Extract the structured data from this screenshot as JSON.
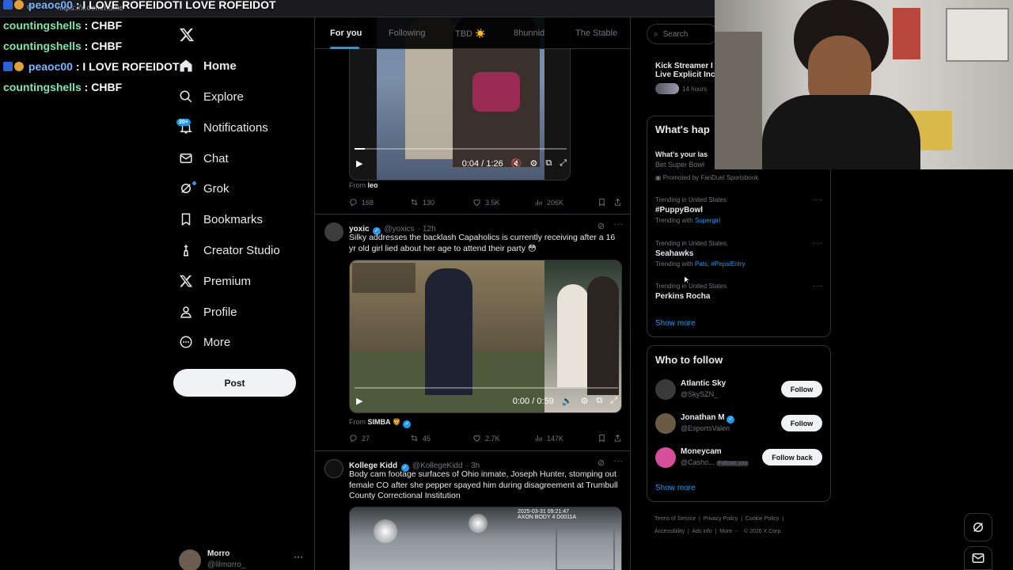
{
  "browser": {
    "url": "https://x.com/home"
  },
  "chat": {
    "lines": [
      {
        "user": "peaoc00",
        "msg": " : I LOVE ROFEIDOTI LOVE ROFEIDOT"
      },
      {
        "user": "countingshells",
        "msg": " : CHBF"
      },
      {
        "user": "countingshells",
        "msg": " : CHBF"
      },
      {
        "user": "peaoc00",
        "msg": " : I LOVE ROFEIDOT"
      },
      {
        "user": "countingshells",
        "msg": " : CHBF"
      }
    ]
  },
  "nav": {
    "items": [
      {
        "label": "Home",
        "icon": "home-icon"
      },
      {
        "label": "Explore",
        "icon": "search-icon"
      },
      {
        "label": "Notifications",
        "icon": "bell-icon"
      },
      {
        "label": "Chat",
        "icon": "mail-icon"
      },
      {
        "label": "Grok",
        "icon": "grok-icon"
      },
      {
        "label": "Bookmarks",
        "icon": "bookmark-icon"
      },
      {
        "label": "Creator Studio",
        "icon": "creator-icon"
      },
      {
        "label": "Premium",
        "icon": "x-logo-icon"
      },
      {
        "label": "Profile",
        "icon": "person-icon"
      },
      {
        "label": "More",
        "icon": "more-circle-icon"
      }
    ],
    "notif_count": "20+",
    "post_label": "Post"
  },
  "profile": {
    "name": "Morro",
    "handle": "@lilmorro_"
  },
  "tabs": [
    "For you",
    "Following",
    "TBD ☀️",
    "8hunnid",
    "The Stable"
  ],
  "tweet1": {
    "video_time": "0:04 / 1:26",
    "from_prefix": "From",
    "from": "leo",
    "actions": {
      "replies": "168",
      "reposts": "130",
      "likes": "3.5K",
      "views": "206K"
    }
  },
  "tweet2": {
    "name": "yoxic",
    "handle": "@yoxics",
    "time": "· 12h",
    "text": "Silky addresses the backlash Capaholics is currently receiving after a 16 yr old girl lied about her age to attend their party 😳",
    "video_time": "0:00 / 0:59",
    "from_prefix": "From",
    "from": "SIMBA 🦁",
    "actions": {
      "replies": "27",
      "reposts": "45",
      "likes": "2.7K",
      "views": "147K"
    }
  },
  "tweet3": {
    "name": "Kollege Kidd",
    "handle": "@KollegeKidd",
    "time": "· 3h",
    "text": "Body cam footage surfaces of Ohio inmate, Joseph Hunter, stomping out female CO after she pepper spayed him during disagreement at Trumbull County Correctional Institution",
    "bodycam_stamp": "2025-03-31 09:21:47\nAXON BODY 4 D0011A"
  },
  "search": {
    "placeholder": "Search"
  },
  "live": {
    "title_line1": "Kick Streamer I",
    "title_line2": "Live Explicit Inc",
    "time": "14 hours"
  },
  "whats_happening": {
    "heading": "What's hap",
    "promo_title": "What's your las",
    "promo_sub": "Bet Super Bowl",
    "promo_label": "Promoted by FanDuel Sportsbook",
    "trends": [
      {
        "context": "Trending in United States",
        "name": "#PuppyBowl",
        "with_prefix": "Trending with",
        "with": "Supergirl"
      },
      {
        "context": "Trending in United States",
        "name": "Seahawks",
        "with_prefix": "Trending with",
        "with": "Pats, #PepsiEntry"
      },
      {
        "context": "Trending in United States",
        "name": "Perkins Rocha",
        "with_prefix": "",
        "with": ""
      }
    ],
    "show_more": "Show more"
  },
  "who_to_follow": {
    "heading": "Who to follow",
    "users": [
      {
        "name": "Atlantic Sky",
        "handle": "@SkySZN_",
        "button": "Follow",
        "follows_you": ""
      },
      {
        "name": "Jonathan M",
        "handle": "@EsportsValen",
        "button": "Follow",
        "follows_you": ""
      },
      {
        "name": "Moneycam",
        "handle": "@Casho...",
        "button": "Follow back",
        "follows_you": "Follows you"
      }
    ],
    "show_more": "Show more"
  },
  "footer": {
    "links": [
      "Terms of Service",
      "Privacy Policy",
      "Cookie Policy",
      "Accessibility",
      "Ads info",
      "More ···",
      "© 2026 X Corp."
    ]
  },
  "colors": {
    "accent": "#1d9bf0",
    "chat_user": "#7ee6a9",
    "chat_user_alt": "#7ab5ff"
  }
}
